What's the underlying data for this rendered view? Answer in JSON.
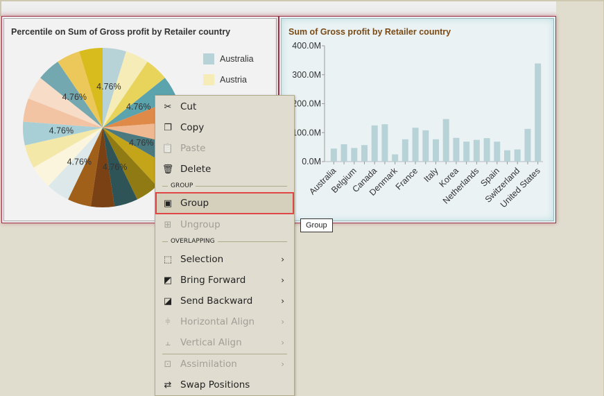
{
  "pie_chart": {
    "title": "Percentile on Sum of Gross profit by Retailer country",
    "legend": [
      {
        "label": "Australia",
        "color": "#b8d3d8"
      },
      {
        "label": "Austria",
        "color": "#f5ecb8"
      }
    ]
  },
  "bar_chart": {
    "title": "Sum of Gross profit by Retailer country"
  },
  "chart_data": [
    {
      "type": "pie",
      "title": "Percentile on Sum of Gross profit by Retailer country",
      "slice_count": 21,
      "values": [
        4.76,
        4.76,
        4.76,
        4.76,
        4.76,
        4.76,
        4.76,
        4.76,
        4.76,
        4.76,
        4.76,
        4.76,
        4.76,
        4.76,
        4.76,
        4.76,
        4.76,
        4.76,
        4.76,
        4.76,
        4.76
      ],
      "data_label": "4.76%",
      "colors": [
        "#b8d3d8",
        "#f5ecb8",
        "#e8d45a",
        "#5ba3ad",
        "#e08a4a",
        "#f0b890",
        "#4a7a80",
        "#c4a418",
        "#8f7a14",
        "#2e5458",
        "#7a4214",
        "#a0601a",
        "#dce8ea",
        "#faf5dc",
        "#f3e8a8",
        "#a9cfd6",
        "#f2c4a4",
        "#f7dcc8",
        "#73a8b0",
        "#ecc85a",
        "#d8bc1e"
      ],
      "legend_position": "right"
    },
    {
      "type": "bar",
      "title": "Sum of Gross profit by Retailer country",
      "xlabel": "",
      "ylabel": "",
      "categories": [
        "Australia",
        "",
        "Belgium",
        "",
        "Canada",
        "",
        "Denmark",
        "",
        "France",
        "",
        "Italy",
        "",
        "Korea",
        "",
        "Netherlands",
        "",
        "Spain",
        "",
        "Switzerland",
        "",
        "United States"
      ],
      "values": [
        45,
        60,
        47,
        57,
        125,
        129,
        25,
        77,
        117,
        108,
        77,
        147,
        82,
        69,
        75,
        81,
        69,
        39,
        42,
        113,
        339
      ],
      "unit": "M",
      "ylim": [
        0,
        400
      ],
      "yticks": [
        "0.0M",
        "100.0M",
        "200.0M",
        "300.0M",
        "400.0M"
      ],
      "bar_color": "#b8d3d8",
      "grid": false
    }
  ],
  "context_menu": {
    "items": [
      {
        "label": "Cut",
        "icon": "scissors-icon",
        "glyph": "✂",
        "enabled": true
      },
      {
        "label": "Copy",
        "icon": "copy-icon",
        "glyph": "❐",
        "enabled": true
      },
      {
        "label": "Paste",
        "icon": "clipboard-icon",
        "glyph": "📋",
        "enabled": false
      },
      {
        "label": "Delete",
        "icon": "trash-icon",
        "glyph": "🗑",
        "enabled": true
      }
    ],
    "group_section": "GROUP",
    "group_items": [
      {
        "label": "Group",
        "icon": "group-icon",
        "glyph": "▣",
        "enabled": true,
        "highlighted": true
      },
      {
        "label": "Ungroup",
        "icon": "ungroup-icon",
        "glyph": "⊞",
        "enabled": false
      }
    ],
    "overlap_section": "OVERLAPPING",
    "overlap_items": [
      {
        "label": "Selection",
        "icon": "selection-icon",
        "glyph": "⬚",
        "enabled": true,
        "submenu": true
      },
      {
        "label": "Bring Forward",
        "icon": "bring-forward-icon",
        "glyph": "◩",
        "enabled": true,
        "submenu": true
      },
      {
        "label": "Send Backward",
        "icon": "send-backward-icon",
        "glyph": "◪",
        "enabled": true,
        "submenu": true
      },
      {
        "label": "Horizontal Align",
        "icon": "horizontal-align-icon",
        "glyph": "⫩",
        "enabled": false,
        "submenu": true
      },
      {
        "label": "Vertical Align",
        "icon": "vertical-align-icon",
        "glyph": "⫠",
        "enabled": false,
        "submenu": true
      }
    ],
    "other_items": [
      {
        "label": "Assimilation",
        "icon": "assimilation-icon",
        "glyph": "⊡",
        "enabled": false,
        "submenu": true
      },
      {
        "label": "Swap Positions",
        "icon": "swap-icon",
        "glyph": "⇄",
        "enabled": true
      }
    ]
  },
  "tooltip": "Group"
}
